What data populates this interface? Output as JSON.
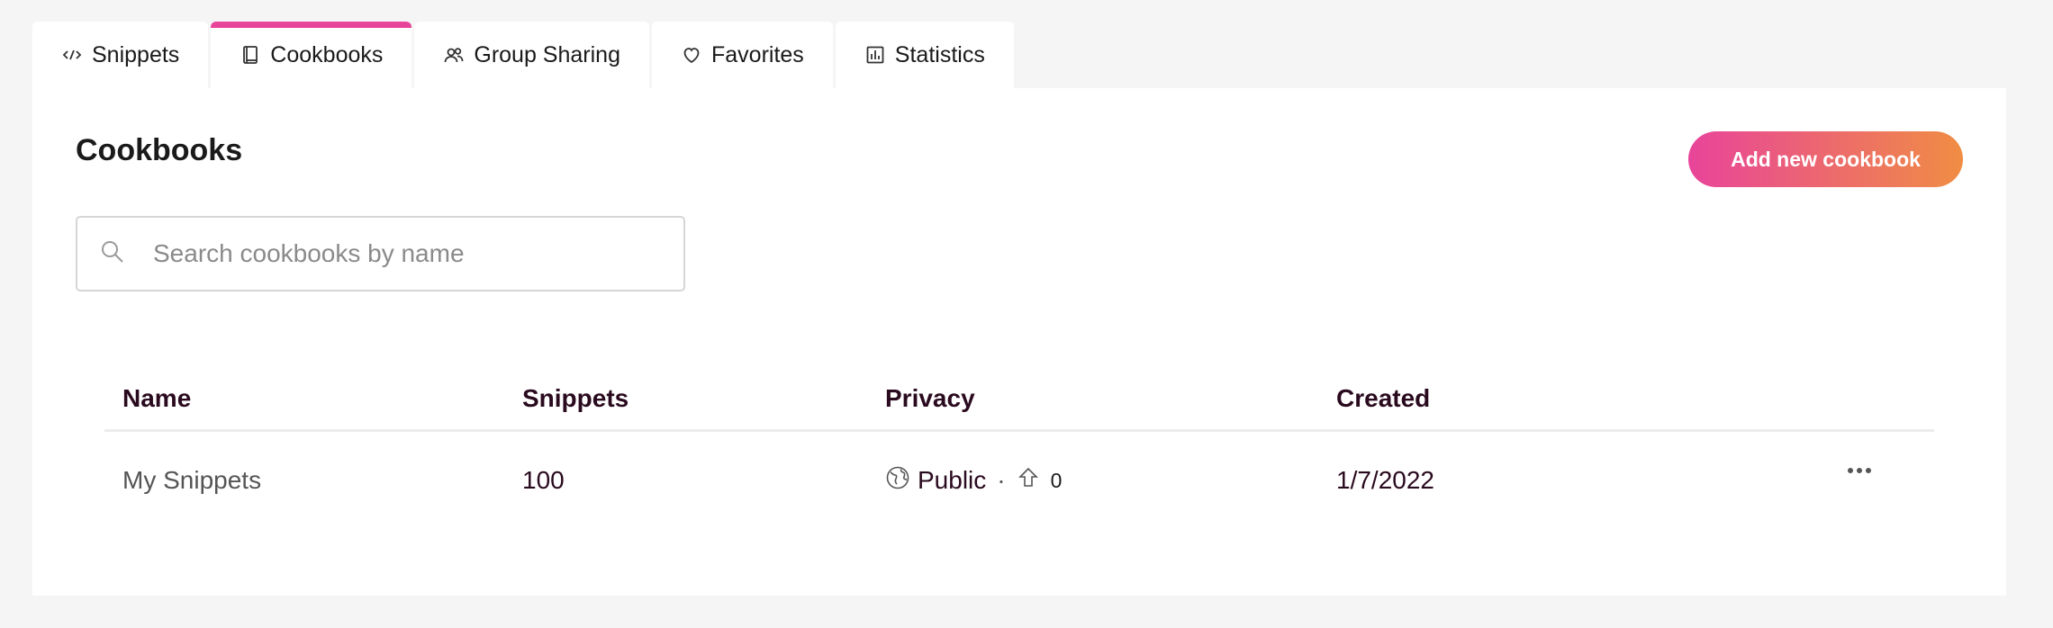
{
  "tabs": [
    {
      "label": "Snippets",
      "icon": "code-icon",
      "active": false
    },
    {
      "label": "Cookbooks",
      "icon": "book-icon",
      "active": true
    },
    {
      "label": "Group Sharing",
      "icon": "users-icon",
      "active": false
    },
    {
      "label": "Favorites",
      "icon": "heart-icon",
      "active": false
    },
    {
      "label": "Statistics",
      "icon": "bar-chart-icon",
      "active": false
    }
  ],
  "page": {
    "title": "Cookbooks",
    "add_button_label": "Add new cookbook"
  },
  "search": {
    "placeholder": "Search cookbooks by name",
    "value": ""
  },
  "table": {
    "headers": [
      "Name",
      "Snippets",
      "Privacy",
      "Created"
    ],
    "rows": [
      {
        "name": "My Snippets",
        "snippets": "100",
        "privacy": "Public",
        "separator": "·",
        "votes": "0",
        "created": "1/7/2022"
      }
    ]
  },
  "colors": {
    "accent": "#e8449a",
    "accent_end": "#f08d43",
    "header_text": "#2a0a1e"
  }
}
